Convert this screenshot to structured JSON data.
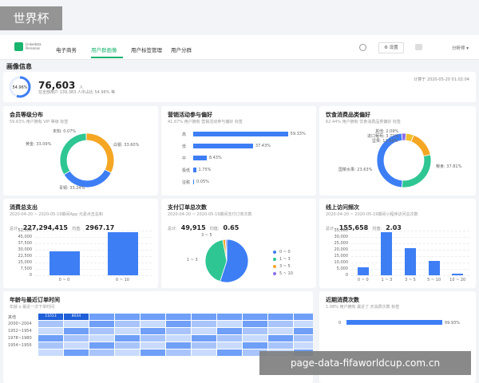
{
  "colors": {
    "blue": "#3d7ef5",
    "green": "#2ec692",
    "orange": "#f5a623",
    "purple": "#8b6fe8",
    "accent": "#19b46e"
  },
  "watermark_tl": "世界杯",
  "watermark_br": "page-data-fifaworldcup.com.cn",
  "nav": {
    "tabs": [
      "电子商务",
      "用户群画像",
      "用户标签管理",
      "用户分群"
    ],
    "active": 1,
    "settings": "设置",
    "user": "分析师"
  },
  "page_title": "画像信息",
  "overview": {
    "percent_badge": "54.96%",
    "percent": 54.96,
    "count": "76,603",
    "unit": "人",
    "desc": "在全部用户 139,383 人中占比 54.96% 等",
    "calc_time": "计算于 2020-05-20 01:02:04"
  },
  "member": {
    "title": "会员等级分布",
    "sub": "59.63% 用户拥有 VIP 等级 标签",
    "labels": [
      "未知: 0.07%",
      "黄金: 33.09%",
      "白银: 33.60%",
      "青铜: 33.24%"
    ]
  },
  "marketing": {
    "title": "营销活动参与偏好",
    "sub": "41.67% 用户拥有 营销活动参与偏好 标签",
    "labels": [
      "高",
      "低",
      "中",
      "极低",
      "征税"
    ],
    "values": [
      59.33,
      37.43,
      8.43,
      1.75,
      0.05
    ],
    "value_labels": [
      "59.33%",
      "37.43%",
      "8.43%",
      "1.75%",
      "0.05%"
    ]
  },
  "food": {
    "title": "饮食消费品类偏好",
    "sub": "62.44% 用户拥有 饮食消费品类偏好 标签",
    "labels": [
      "其他: 2.09%",
      "进口葡萄: 3.71%",
      "坚果: 12.58%",
      "国菜水果: 23.63%",
      "粮食: 37.81%"
    ]
  },
  "spend": {
    "title": "消费总支出",
    "sub": "2020-04-20 ~ 2020-05-19期间App 元素点击总和",
    "total_label": "总计:",
    "total": "227,294,415",
    "avg_label": "均值:",
    "avg": "2967.17",
    "yticks": [
      "52,500",
      "45,000",
      "37,500",
      "30,000",
      "22,500",
      "15,000",
      "7,500",
      "0"
    ],
    "categories": [
      "0 ~ 0",
      "0 ~ 10"
    ],
    "values": [
      28000,
      51000
    ]
  },
  "orders": {
    "title": "支付订单总次数",
    "sub": "2020-04-20 ~ 2020-05-19期间支付订单次数",
    "total_label": "总计:",
    "total": "49,915",
    "avg_label": "均值:",
    "avg": "0.65",
    "slice_labels": [
      "3 ~ 5",
      "1 ~ 3"
    ],
    "legend": [
      "0 ~ 0",
      "1 ~ 3",
      "3 ~ 5",
      "5 ~ 10"
    ]
  },
  "visits": {
    "title": "线上访问频次",
    "sub": "2020-04-20 ~ 2020-05-19期间小程序访问总次数",
    "total_label": "总计:",
    "total": "155,658",
    "avg_label": "均值:",
    "avg": "2.03",
    "yticks": [
      "35,000",
      "30,000",
      "25,000",
      "20,000",
      "15,000",
      "10,000",
      "5,000",
      "0"
    ],
    "categories": [
      "0 ~ 0",
      "1 ~ 3",
      "3 ~ 5",
      "5 ~ 10",
      "10 ~ 20"
    ],
    "values": [
      6000,
      34000,
      21000,
      11000,
      1000
    ]
  },
  "age": {
    "title": "年龄与最近订单时间",
    "sub": "年龄 x 最近一次下单时间",
    "col1": "11013",
    "col2": "8034",
    "row_header": "其他",
    "rows": [
      "2000~2004",
      "1952~1954",
      "1978~1980",
      "1954~1956"
    ]
  },
  "recent": {
    "title": "近期消费次数",
    "sub": "1.08% 用户拥有 最近了 天消费次数 标签",
    "value_label": "99.93%",
    "value": 99.93,
    "zero": "0"
  },
  "chart_data": [
    {
      "type": "pie",
      "title": "会员等级分布",
      "categories": [
        "未知",
        "黄金",
        "白银",
        "青铜"
      ],
      "values": [
        0.07,
        33.09,
        33.6,
        33.24
      ]
    },
    {
      "type": "bar",
      "title": "营销活动参与偏好",
      "categories": [
        "高",
        "低",
        "中",
        "极低",
        "征税"
      ],
      "values": [
        59.33,
        37.43,
        8.43,
        1.75,
        0.05
      ]
    },
    {
      "type": "pie",
      "title": "饮食消费品类偏好",
      "categories": [
        "其他",
        "进口葡萄",
        "坚果",
        "国菜水果",
        "粮食"
      ],
      "values": [
        2.09,
        3.71,
        12.58,
        23.63,
        37.81
      ]
    },
    {
      "type": "bar",
      "title": "消费总支出",
      "categories": [
        "0 ~ 0",
        "0 ~ 10"
      ],
      "values": [
        28000,
        51000
      ],
      "ylim": [
        0,
        52500
      ]
    },
    {
      "type": "pie",
      "title": "支付订单总次数",
      "categories": [
        "0 ~ 0",
        "1 ~ 3",
        "3 ~ 5",
        "5 ~ 10"
      ],
      "values": [
        55,
        42,
        2,
        1
      ]
    },
    {
      "type": "bar",
      "title": "线上访问频次",
      "categories": [
        "0 ~ 0",
        "1 ~ 3",
        "3 ~ 5",
        "5 ~ 10",
        "10 ~ 20"
      ],
      "values": [
        6000,
        34000,
        21000,
        11000,
        1000
      ],
      "ylim": [
        0,
        35000
      ]
    },
    {
      "type": "bar",
      "title": "近期消费次数",
      "categories": [
        "0"
      ],
      "values": [
        99.93
      ]
    }
  ]
}
